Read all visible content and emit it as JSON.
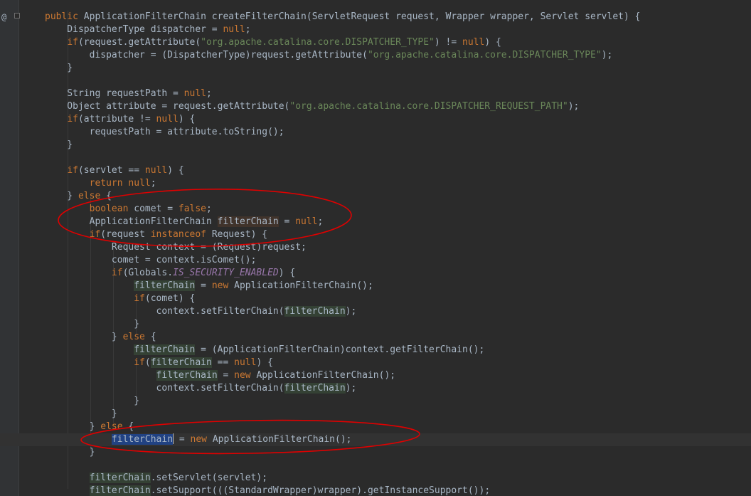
{
  "editor": {
    "gutter_marker": "@",
    "lines": [
      [
        [
          "kw",
          "public "
        ],
        [
          "",
          "ApplicationFilterChain createFilterChain(ServletRequest request, Wrapper wrapper, Servlet servlet) {"
        ]
      ],
      [
        [
          "",
          "    DispatcherType dispatcher = "
        ],
        [
          "kw",
          "null"
        ],
        [
          "",
          ";"
        ]
      ],
      [
        [
          "",
          "    "
        ],
        [
          "kw",
          "if"
        ],
        [
          "",
          "(request.getAttribute("
        ],
        [
          "str",
          "\"org.apache.catalina.core.DISPATCHER_TYPE\""
        ],
        [
          "",
          ") != "
        ],
        [
          "kw",
          "null"
        ],
        [
          "",
          ") {"
        ]
      ],
      [
        [
          "",
          "        dispatcher = (DispatcherType)request.getAttribute("
        ],
        [
          "str",
          "\"org.apache.catalina.core.DISPATCHER_TYPE\""
        ],
        [
          "",
          ");"
        ]
      ],
      [
        [
          "",
          "    }"
        ]
      ],
      [
        [
          "",
          ""
        ]
      ],
      [
        [
          "",
          "    String requestPath = "
        ],
        [
          "kw",
          "null"
        ],
        [
          "",
          ";"
        ]
      ],
      [
        [
          "",
          "    Object attribute = request.getAttribute("
        ],
        [
          "str",
          "\"org.apache.catalina.core.DISPATCHER_REQUEST_PATH\""
        ],
        [
          "",
          ");"
        ]
      ],
      [
        [
          "",
          "    "
        ],
        [
          "kw",
          "if"
        ],
        [
          "",
          "(attribute != "
        ],
        [
          "kw",
          "null"
        ],
        [
          "",
          ") {"
        ]
      ],
      [
        [
          "",
          "        requestPath = attribute.toString();"
        ]
      ],
      [
        [
          "",
          "    }"
        ]
      ],
      [
        [
          "",
          ""
        ]
      ],
      [
        [
          "",
          "    "
        ],
        [
          "kw",
          "if"
        ],
        [
          "",
          "(servlet == "
        ],
        [
          "kw",
          "null"
        ],
        [
          "",
          ") {"
        ]
      ],
      [
        [
          "",
          "        "
        ],
        [
          "kw",
          "return null"
        ],
        [
          "",
          ";"
        ]
      ],
      [
        [
          "",
          "    } "
        ],
        [
          "kw",
          "else "
        ],
        [
          "",
          "{"
        ]
      ],
      [
        [
          "",
          "        "
        ],
        [
          "kw",
          "boolean "
        ],
        [
          "",
          "comet = "
        ],
        [
          "kw",
          "false"
        ],
        [
          "",
          ";"
        ]
      ],
      [
        [
          "",
          "        ApplicationFilterChain "
        ],
        [
          "hl-decl",
          "filterChain"
        ],
        [
          "",
          " = "
        ],
        [
          "kw",
          "null"
        ],
        [
          "",
          ";"
        ]
      ],
      [
        [
          "",
          "        "
        ],
        [
          "kw",
          "if"
        ],
        [
          "",
          "(request "
        ],
        [
          "kw",
          "instanceof "
        ],
        [
          "",
          "Request) {"
        ]
      ],
      [
        [
          "",
          "            Request context = (Request)request;"
        ]
      ],
      [
        [
          "",
          "            comet = context.isComet();"
        ]
      ],
      [
        [
          "",
          "            "
        ],
        [
          "kw",
          "if"
        ],
        [
          "",
          "(Globals."
        ],
        [
          "fld",
          "IS_SECURITY_ENABLED"
        ],
        [
          "",
          ") {"
        ]
      ],
      [
        [
          "",
          "                "
        ],
        [
          "hl-var",
          "filterChain"
        ],
        [
          "",
          " = "
        ],
        [
          "kw",
          "new "
        ],
        [
          "",
          "ApplicationFilterChain();"
        ]
      ],
      [
        [
          "",
          "                "
        ],
        [
          "kw",
          "if"
        ],
        [
          "",
          "(comet) {"
        ]
      ],
      [
        [
          "",
          "                    context.setFilterChain("
        ],
        [
          "hl-var",
          "filterChain"
        ],
        [
          "",
          ");"
        ]
      ],
      [
        [
          "",
          "                }"
        ]
      ],
      [
        [
          "",
          "            } "
        ],
        [
          "kw",
          "else "
        ],
        [
          "",
          "{"
        ]
      ],
      [
        [
          "",
          "                "
        ],
        [
          "hl-var",
          "filterChain"
        ],
        [
          "",
          " = (ApplicationFilterChain)context.getFilterChain();"
        ]
      ],
      [
        [
          "",
          "                "
        ],
        [
          "kw",
          "if"
        ],
        [
          "",
          "("
        ],
        [
          "hl-var",
          "filterChain"
        ],
        [
          "",
          " == "
        ],
        [
          "kw",
          "null"
        ],
        [
          "",
          ") {"
        ]
      ],
      [
        [
          "",
          "                    "
        ],
        [
          "hl-var",
          "filterChain"
        ],
        [
          "",
          " = "
        ],
        [
          "kw",
          "new "
        ],
        [
          "",
          "ApplicationFilterChain();"
        ]
      ],
      [
        [
          "",
          "                    context.setFilterChain("
        ],
        [
          "hl-var",
          "filterChain"
        ],
        [
          "",
          ");"
        ]
      ],
      [
        [
          "",
          "                }"
        ]
      ],
      [
        [
          "",
          "            }"
        ]
      ],
      [
        [
          "",
          "        } "
        ],
        [
          "kw",
          "else "
        ],
        [
          "",
          "{"
        ]
      ],
      [
        [
          "",
          "            "
        ],
        [
          "sel",
          "filterChain"
        ],
        [
          "caret",
          ""
        ],
        [
          "",
          " = "
        ],
        [
          "kw",
          "new "
        ],
        [
          "",
          "ApplicationFilterChain();"
        ]
      ],
      [
        [
          "",
          "        }"
        ]
      ],
      [
        [
          "",
          ""
        ]
      ],
      [
        [
          "",
          "        "
        ],
        [
          "hl-var",
          "filterChain"
        ],
        [
          "",
          ".setServlet(servlet);"
        ]
      ],
      [
        [
          "",
          "        "
        ],
        [
          "hl-var",
          "filterChain"
        ],
        [
          "",
          ".setSupport(((StandardWrapper)wrapper).getInstanceSupport());"
        ]
      ]
    ],
    "current_line": 33,
    "annotations": {
      "color": "#e00000",
      "ellipses": [
        {
          "label": "declaration-circle",
          "wraps_lines": [
            15,
            16
          ]
        },
        {
          "label": "else-assignment-circle",
          "wraps_lines": [
            33
          ]
        }
      ]
    }
  }
}
